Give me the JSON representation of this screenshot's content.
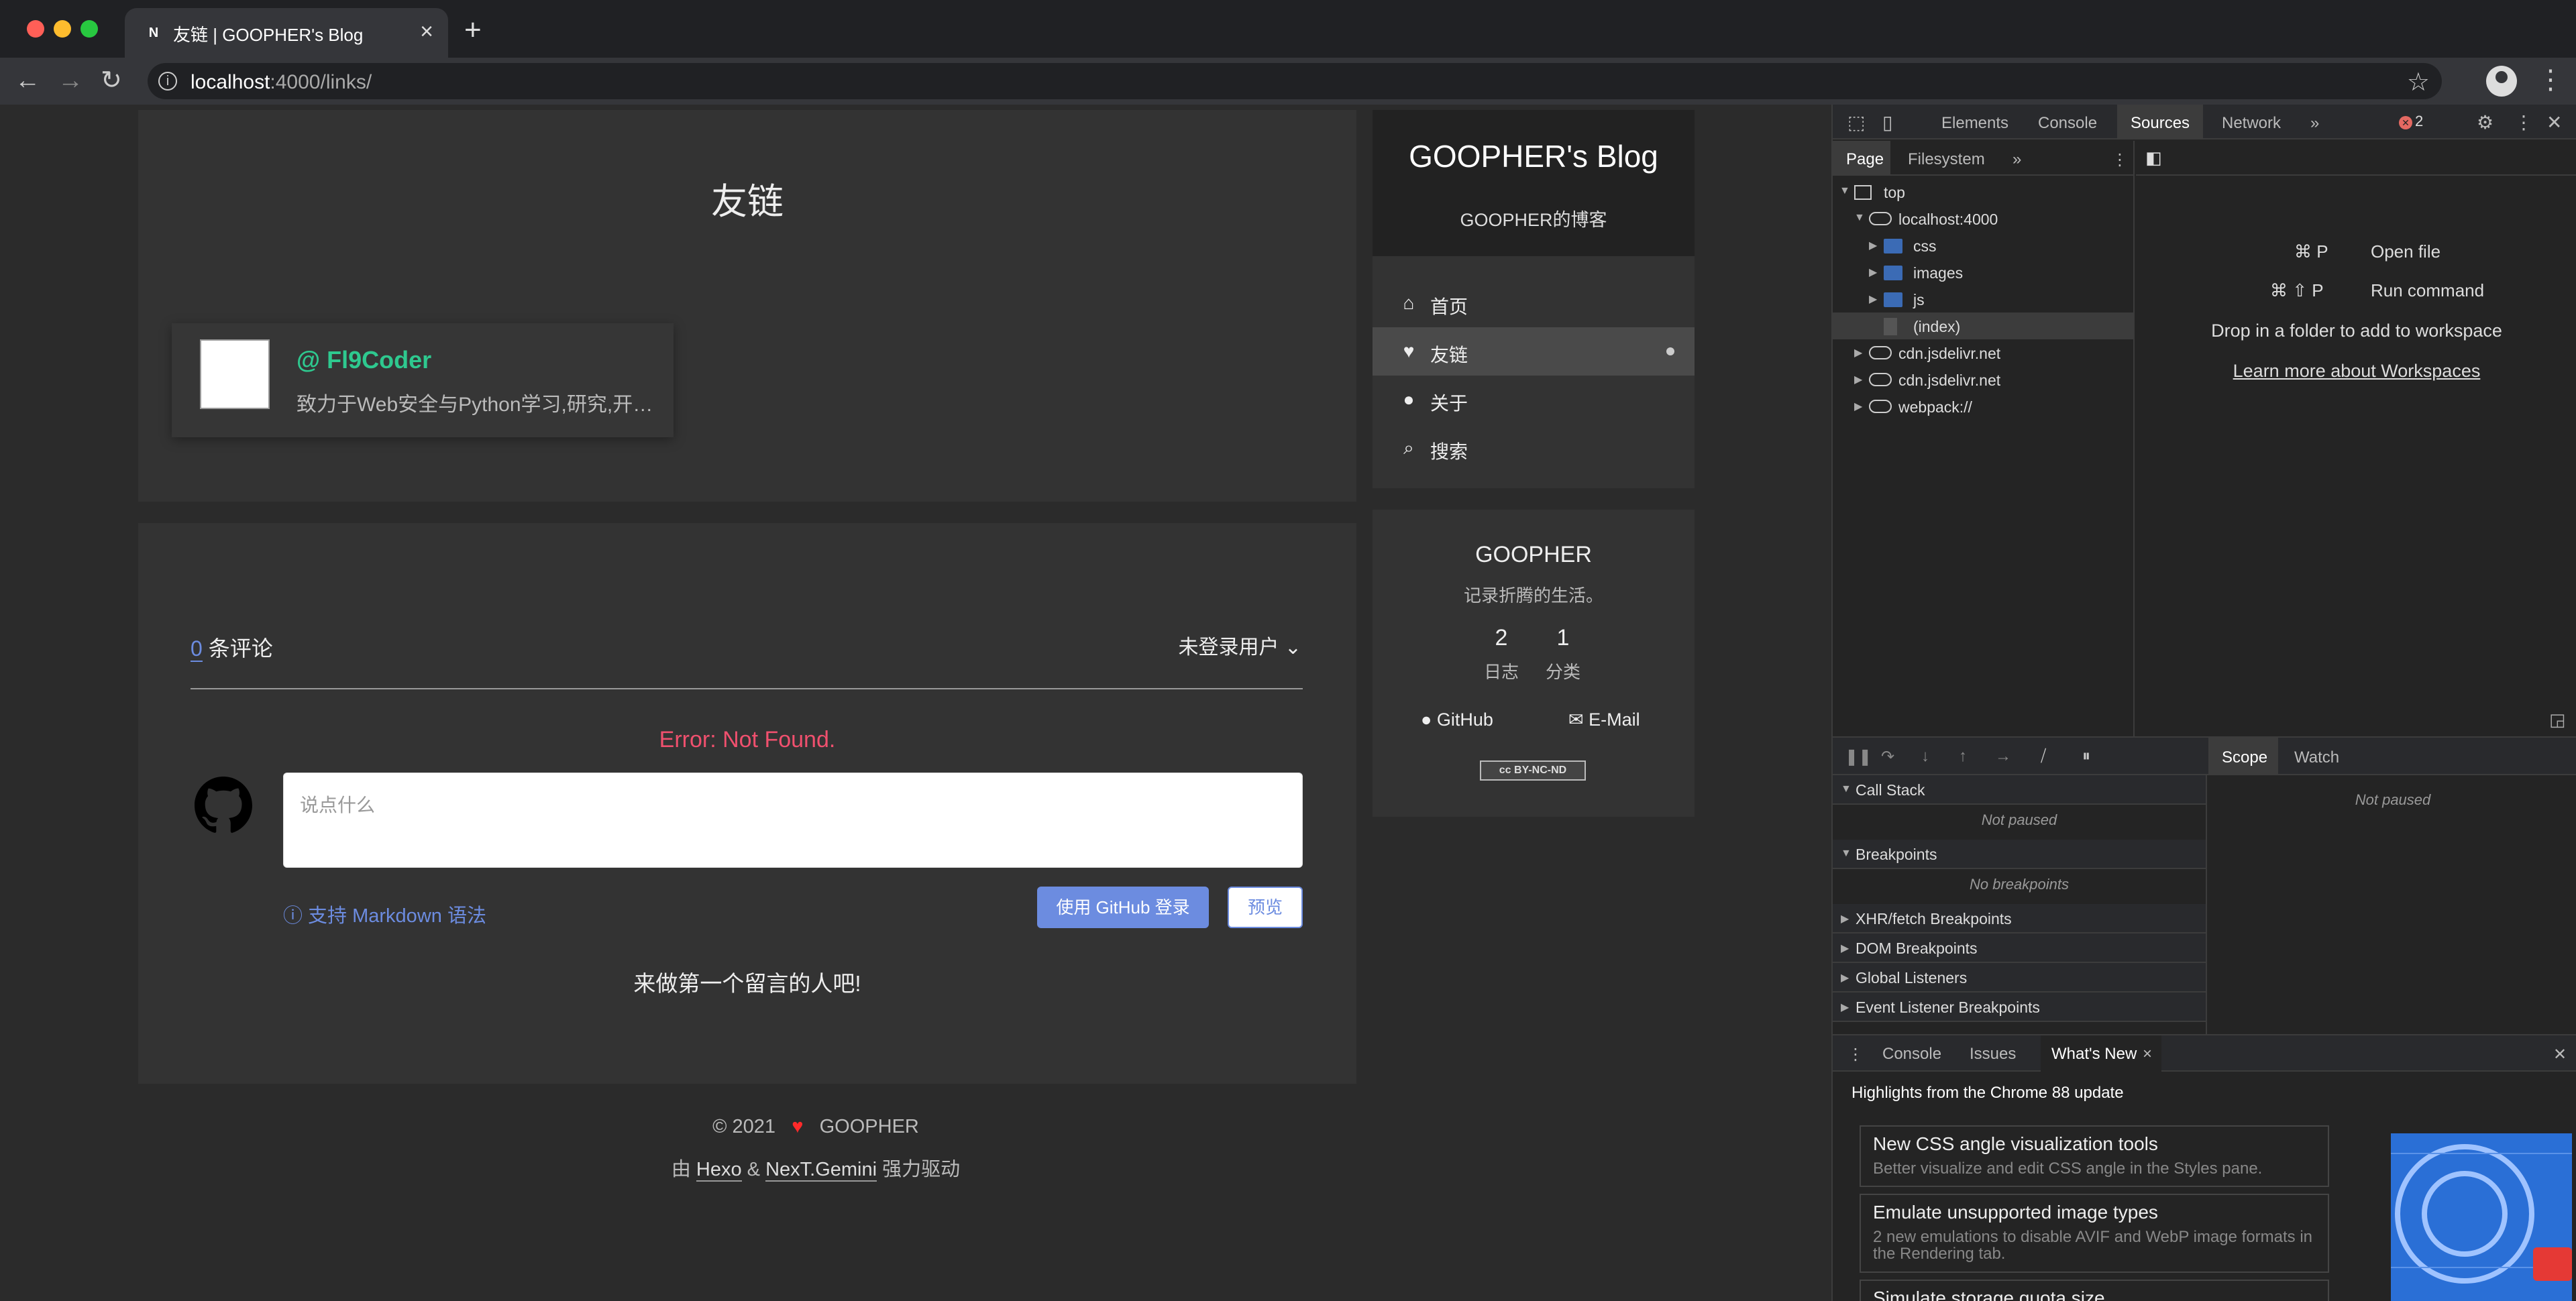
{
  "browser": {
    "tab_title": "友链 | GOOPHER's Blog",
    "tab_favicon": "N",
    "tab_close": "×",
    "new_tab": "+",
    "url_host": "localhost",
    "url_rest": ":4000/links/",
    "back": "←",
    "forward": "→",
    "reload": "↻",
    "star": "☆",
    "menu": "⋮",
    "info": "i",
    "traffic_colors": [
      "#ff5f57",
      "#febc2e",
      "#28c840"
    ]
  },
  "page": {
    "post_title": "友链",
    "link": {
      "name": "@ Fl9Coder",
      "desc": "致力于Web安全与Python学习,研究,开发。"
    },
    "comments": {
      "count": "0",
      "count_suffix": " 条评论",
      "user": "未登录用户 ⌄",
      "error": "Error: Not Found.",
      "placeholder": "说点什么",
      "markdown_hint": "ⓘ 支持 Markdown 语法",
      "github_login": "使用 GitHub 登录",
      "preview": "预览",
      "first_comment": "来做第一个留言的人吧!"
    },
    "footer": {
      "copyright": "© 2021",
      "heart": "♥",
      "author": "GOOPHER",
      "powered_prefix": "由",
      "hexo": "Hexo",
      "amp": "&",
      "theme": "NexT.Gemini",
      "powered_suffix": "强力驱动"
    }
  },
  "sidebar": {
    "title": "GOOPHER's Blog",
    "subtitle": "GOOPHER的博客",
    "menu": [
      {
        "icon": "⌂",
        "label": "首页"
      },
      {
        "icon": "♥",
        "label": "友链"
      },
      {
        "icon": "●",
        "label": "关于"
      },
      {
        "icon": "⌕",
        "label": "搜索"
      }
    ],
    "author": "GOOPHER",
    "motto": "记录折腾的生活。",
    "stats": [
      {
        "num": "2",
        "label": "日志"
      },
      {
        "num": "1",
        "label": "分类"
      }
    ],
    "github": "GitHub",
    "email": "E-Mail",
    "github_icon": "●",
    "email_icon": "✉",
    "license": "cc BY-NC-ND"
  },
  "devtools": {
    "tabs": [
      "Elements",
      "Console",
      "Sources",
      "Network"
    ],
    "more": "»",
    "errors": "2",
    "error_icon": "✕",
    "settings_icon": "⚙",
    "kebab_icon": "⋮",
    "close_icon": "✕",
    "inspect_icon": "⬚",
    "device_icon": "▯",
    "navigator_tabs": [
      "Page",
      "Filesystem"
    ],
    "navigator_more": "»",
    "navigator_menu": "⋮",
    "tree": [
      {
        "label": "top",
        "type": "frame",
        "expanded": true,
        "depth": 0
      },
      {
        "label": "localhost:4000",
        "type": "cloud",
        "expanded": true,
        "depth": 1
      },
      {
        "label": "css",
        "type": "folder",
        "expanded": false,
        "depth": 2
      },
      {
        "label": "images",
        "type": "folder",
        "expanded": false,
        "depth": 2
      },
      {
        "label": "js",
        "type": "folder",
        "expanded": false,
        "depth": 2
      },
      {
        "label": "(index)",
        "type": "doc",
        "expanded": null,
        "depth": 2
      },
      {
        "label": "cdn.jsdelivr.net",
        "type": "cloud",
        "expanded": false,
        "depth": 1
      },
      {
        "label": "cdn.jsdelivr.net",
        "type": "cloud",
        "expanded": false,
        "depth": 1
      },
      {
        "label": "webpack://",
        "type": "cloud",
        "expanded": false,
        "depth": 1
      }
    ],
    "tri_expanded": "▼",
    "tri_collapsed": "▶",
    "editor": {
      "toggle_icon": "◧",
      "open_file_keys": "⌘ P",
      "open_file": "Open file",
      "run_command_keys": "⌘ ⇧ P",
      "run_command": "Run command",
      "drop_folder": "Drop in a folder to add to workspace",
      "learn_more": "Learn more about Workspaces",
      "corner_icon": "◲"
    },
    "debug_icons": [
      "❚❚",
      "↷",
      "↓",
      "↑",
      "→",
      "⧸",
      "⏸"
    ],
    "scope_tabs": [
      "Scope",
      "Watch"
    ],
    "sections": [
      {
        "label": "Call Stack",
        "expanded": true,
        "empty": "Not paused"
      },
      {
        "label": "Breakpoints",
        "expanded": true,
        "empty": "No breakpoints"
      },
      {
        "label": "XHR/fetch Breakpoints",
        "expanded": false
      },
      {
        "label": "DOM Breakpoints",
        "expanded": false
      },
      {
        "label": "Global Listeners",
        "expanded": false
      },
      {
        "label": "Event Listener Breakpoints",
        "expanded": false
      }
    ],
    "scope_empty": "Not paused",
    "drawer": {
      "menu": "⋮",
      "tabs": [
        "Console",
        "Issues",
        "What's New"
      ],
      "close_tab": "×",
      "close": "✕",
      "highlights": "Highlights from the Chrome 88 update",
      "cards": [
        {
          "title": "New CSS angle visualization tools",
          "desc": "Better visualize and edit CSS angle in the Styles pane."
        },
        {
          "title": "Emulate unsupported image types",
          "desc": "2 new emulations to disable AVIF and WebP image formats in the Rendering tab."
        },
        {
          "title": "Simulate storage quota size",
          "desc": ""
        }
      ]
    }
  }
}
